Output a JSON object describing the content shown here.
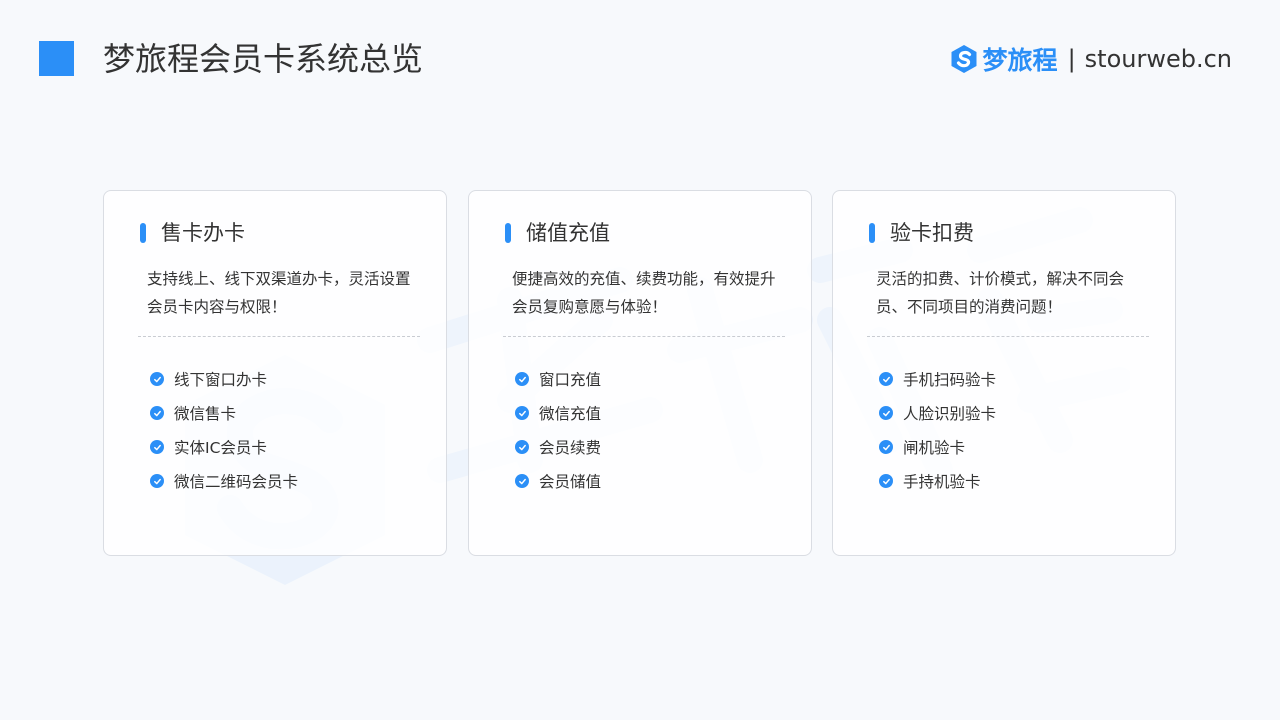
{
  "header": {
    "title": "梦旅程会员卡系统总览",
    "brand_name": "梦旅程",
    "separator": "|",
    "brand_url": "stourweb.cn"
  },
  "colors": {
    "accent": "#2b8ff7",
    "text": "#333333",
    "background": "#f7f9fc"
  },
  "cards": [
    {
      "title": "售卡办卡",
      "desc": "支持线上、线下双渠道办卡，灵活设置会员卡内容与权限！",
      "items": [
        "线下窗口办卡",
        "微信售卡",
        "实体IC会员卡",
        "微信二维码会员卡"
      ]
    },
    {
      "title": "储值充值",
      "desc": "便捷高效的充值、续费功能，有效提升会员复购意愿与体验！",
      "items": [
        "窗口充值",
        "微信充值",
        "会员续费",
        "会员储值"
      ]
    },
    {
      "title": "验卡扣费",
      "desc": "灵活的扣费、计价模式，解决不同会员、不同项目的消费问题！",
      "items": [
        "手机扫码验卡",
        "人脸识别验卡",
        "闸机验卡",
        "手持机验卡"
      ]
    }
  ]
}
